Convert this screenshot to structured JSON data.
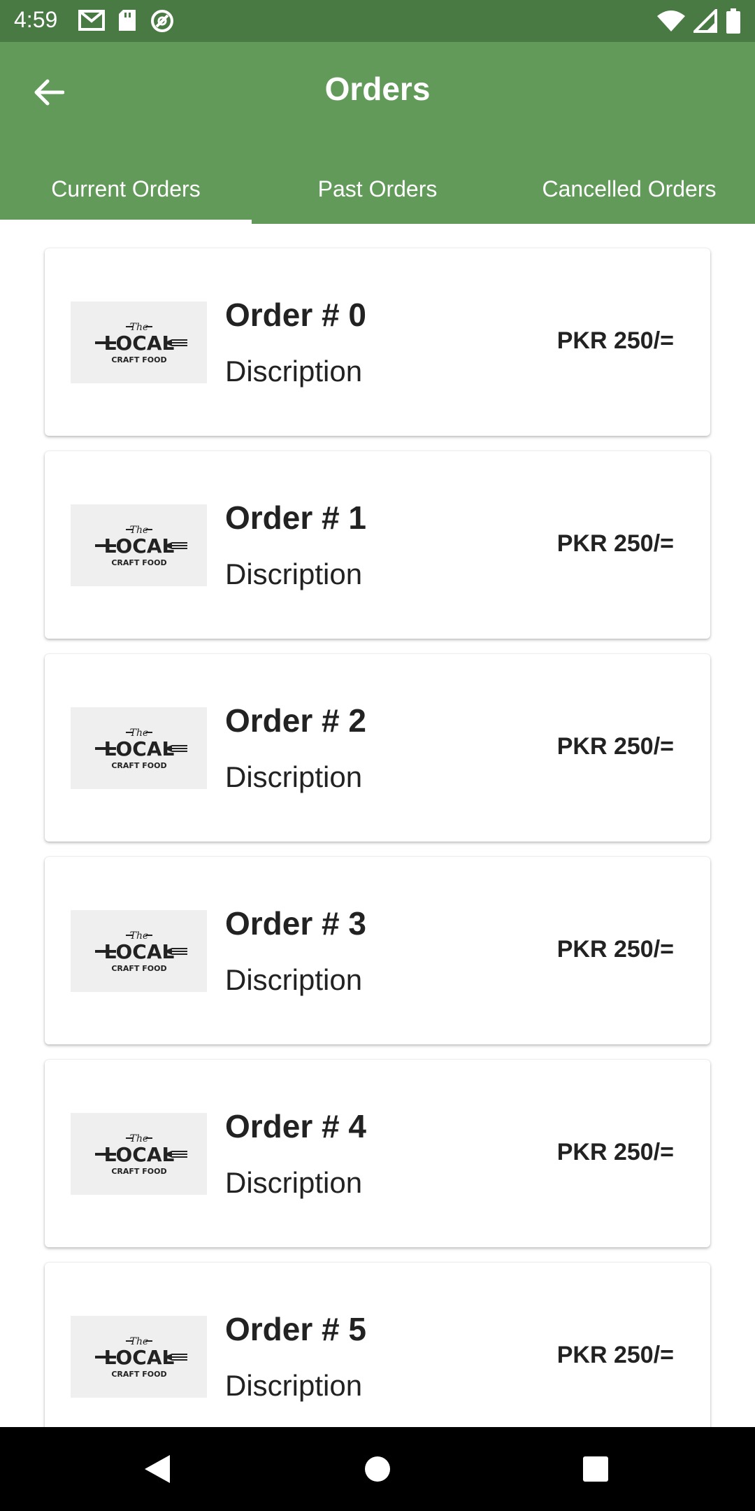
{
  "status_bar": {
    "time": "4:59",
    "left_icons": [
      "gmail-icon",
      "sd-card-icon",
      "data-saver-icon"
    ],
    "right_icons": [
      "wifi-icon",
      "signal-icon",
      "battery-icon"
    ]
  },
  "app_bar": {
    "back_icon": "arrow-back-icon",
    "title": "Orders"
  },
  "tabs": [
    {
      "label": "Current Orders",
      "active": true
    },
    {
      "label": "Past Orders",
      "active": false
    },
    {
      "label": "Cancelled Orders",
      "active": false
    }
  ],
  "orders": [
    {
      "title": "Order # 0",
      "description": "Discription",
      "price": "PKR 250/="
    },
    {
      "title": "Order # 1",
      "description": "Discription",
      "price": "PKR 250/="
    },
    {
      "title": "Order # 2",
      "description": "Discription",
      "price": "PKR 250/="
    },
    {
      "title": "Order # 3",
      "description": "Discription",
      "price": "PKR 250/="
    },
    {
      "title": "Order # 4",
      "description": "Discription",
      "price": "PKR 250/="
    },
    {
      "title": "Order # 5",
      "description": "Discription",
      "price": "PKR 250/="
    }
  ],
  "logo": {
    "line1": "The",
    "line2": "LOCAL",
    "line3": "CRAFT FOOD"
  },
  "colors": {
    "app_bar": "#629a5a",
    "status_bar": "#4a7a44",
    "nav_bar": "#000000"
  },
  "nav_bar": {
    "buttons": [
      "back-triangle-icon",
      "home-circle-icon",
      "recents-square-icon"
    ]
  }
}
